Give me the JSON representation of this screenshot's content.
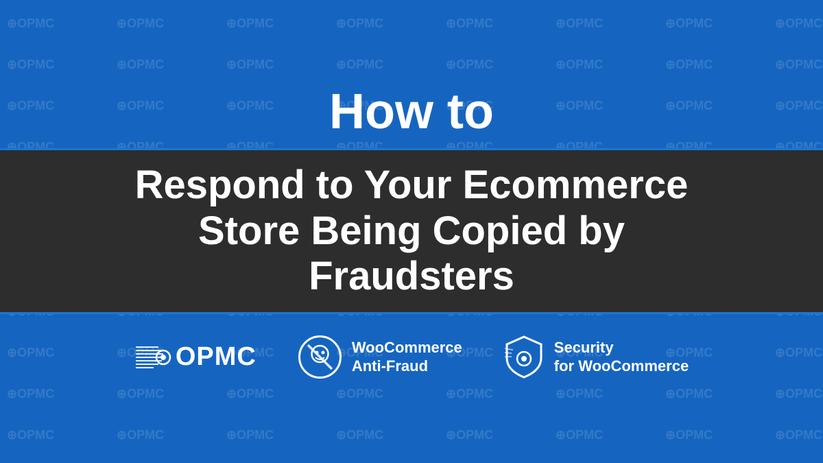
{
  "background": {
    "color": "#1565C0"
  },
  "header": {
    "how_to": "How to"
  },
  "banner": {
    "line1": "Respond to Your Ecommerce",
    "line2": "Store Being Copied by",
    "line3": "Fraudsters"
  },
  "logos": [
    {
      "name": "OPMC",
      "type": "opmc"
    },
    {
      "name": "WooCommerce Anti-Fraud",
      "line1": "WooCommerce",
      "line2": "Anti-Fraud",
      "type": "woocommerce"
    },
    {
      "name": "Security for WooCommerce",
      "line1": "Security",
      "line2": "for WooCommerce",
      "type": "security"
    }
  ],
  "watermark": {
    "text": "OPMC"
  }
}
